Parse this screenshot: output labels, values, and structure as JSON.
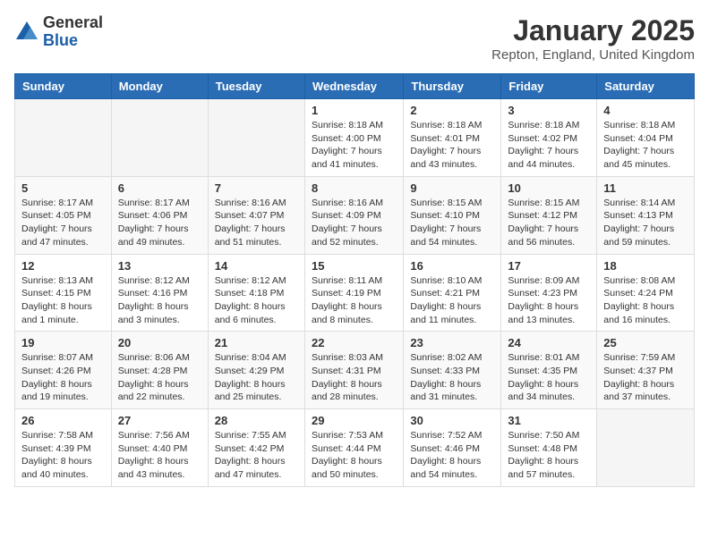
{
  "logo": {
    "general": "General",
    "blue": "Blue"
  },
  "title": "January 2025",
  "location": "Repton, England, United Kingdom",
  "weekdays": [
    "Sunday",
    "Monday",
    "Tuesday",
    "Wednesday",
    "Thursday",
    "Friday",
    "Saturday"
  ],
  "weeks": [
    [
      {
        "day": "",
        "sunrise": "",
        "sunset": "",
        "daylight": ""
      },
      {
        "day": "",
        "sunrise": "",
        "sunset": "",
        "daylight": ""
      },
      {
        "day": "",
        "sunrise": "",
        "sunset": "",
        "daylight": ""
      },
      {
        "day": "1",
        "sunrise": "Sunrise: 8:18 AM",
        "sunset": "Sunset: 4:00 PM",
        "daylight": "Daylight: 7 hours and 41 minutes."
      },
      {
        "day": "2",
        "sunrise": "Sunrise: 8:18 AM",
        "sunset": "Sunset: 4:01 PM",
        "daylight": "Daylight: 7 hours and 43 minutes."
      },
      {
        "day": "3",
        "sunrise": "Sunrise: 8:18 AM",
        "sunset": "Sunset: 4:02 PM",
        "daylight": "Daylight: 7 hours and 44 minutes."
      },
      {
        "day": "4",
        "sunrise": "Sunrise: 8:18 AM",
        "sunset": "Sunset: 4:04 PM",
        "daylight": "Daylight: 7 hours and 45 minutes."
      }
    ],
    [
      {
        "day": "5",
        "sunrise": "Sunrise: 8:17 AM",
        "sunset": "Sunset: 4:05 PM",
        "daylight": "Daylight: 7 hours and 47 minutes."
      },
      {
        "day": "6",
        "sunrise": "Sunrise: 8:17 AM",
        "sunset": "Sunset: 4:06 PM",
        "daylight": "Daylight: 7 hours and 49 minutes."
      },
      {
        "day": "7",
        "sunrise": "Sunrise: 8:16 AM",
        "sunset": "Sunset: 4:07 PM",
        "daylight": "Daylight: 7 hours and 51 minutes."
      },
      {
        "day": "8",
        "sunrise": "Sunrise: 8:16 AM",
        "sunset": "Sunset: 4:09 PM",
        "daylight": "Daylight: 7 hours and 52 minutes."
      },
      {
        "day": "9",
        "sunrise": "Sunrise: 8:15 AM",
        "sunset": "Sunset: 4:10 PM",
        "daylight": "Daylight: 7 hours and 54 minutes."
      },
      {
        "day": "10",
        "sunrise": "Sunrise: 8:15 AM",
        "sunset": "Sunset: 4:12 PM",
        "daylight": "Daylight: 7 hours and 56 minutes."
      },
      {
        "day": "11",
        "sunrise": "Sunrise: 8:14 AM",
        "sunset": "Sunset: 4:13 PM",
        "daylight": "Daylight: 7 hours and 59 minutes."
      }
    ],
    [
      {
        "day": "12",
        "sunrise": "Sunrise: 8:13 AM",
        "sunset": "Sunset: 4:15 PM",
        "daylight": "Daylight: 8 hours and 1 minute."
      },
      {
        "day": "13",
        "sunrise": "Sunrise: 8:12 AM",
        "sunset": "Sunset: 4:16 PM",
        "daylight": "Daylight: 8 hours and 3 minutes."
      },
      {
        "day": "14",
        "sunrise": "Sunrise: 8:12 AM",
        "sunset": "Sunset: 4:18 PM",
        "daylight": "Daylight: 8 hours and 6 minutes."
      },
      {
        "day": "15",
        "sunrise": "Sunrise: 8:11 AM",
        "sunset": "Sunset: 4:19 PM",
        "daylight": "Daylight: 8 hours and 8 minutes."
      },
      {
        "day": "16",
        "sunrise": "Sunrise: 8:10 AM",
        "sunset": "Sunset: 4:21 PM",
        "daylight": "Daylight: 8 hours and 11 minutes."
      },
      {
        "day": "17",
        "sunrise": "Sunrise: 8:09 AM",
        "sunset": "Sunset: 4:23 PM",
        "daylight": "Daylight: 8 hours and 13 minutes."
      },
      {
        "day": "18",
        "sunrise": "Sunrise: 8:08 AM",
        "sunset": "Sunset: 4:24 PM",
        "daylight": "Daylight: 8 hours and 16 minutes."
      }
    ],
    [
      {
        "day": "19",
        "sunrise": "Sunrise: 8:07 AM",
        "sunset": "Sunset: 4:26 PM",
        "daylight": "Daylight: 8 hours and 19 minutes."
      },
      {
        "day": "20",
        "sunrise": "Sunrise: 8:06 AM",
        "sunset": "Sunset: 4:28 PM",
        "daylight": "Daylight: 8 hours and 22 minutes."
      },
      {
        "day": "21",
        "sunrise": "Sunrise: 8:04 AM",
        "sunset": "Sunset: 4:29 PM",
        "daylight": "Daylight: 8 hours and 25 minutes."
      },
      {
        "day": "22",
        "sunrise": "Sunrise: 8:03 AM",
        "sunset": "Sunset: 4:31 PM",
        "daylight": "Daylight: 8 hours and 28 minutes."
      },
      {
        "day": "23",
        "sunrise": "Sunrise: 8:02 AM",
        "sunset": "Sunset: 4:33 PM",
        "daylight": "Daylight: 8 hours and 31 minutes."
      },
      {
        "day": "24",
        "sunrise": "Sunrise: 8:01 AM",
        "sunset": "Sunset: 4:35 PM",
        "daylight": "Daylight: 8 hours and 34 minutes."
      },
      {
        "day": "25",
        "sunrise": "Sunrise: 7:59 AM",
        "sunset": "Sunset: 4:37 PM",
        "daylight": "Daylight: 8 hours and 37 minutes."
      }
    ],
    [
      {
        "day": "26",
        "sunrise": "Sunrise: 7:58 AM",
        "sunset": "Sunset: 4:39 PM",
        "daylight": "Daylight: 8 hours and 40 minutes."
      },
      {
        "day": "27",
        "sunrise": "Sunrise: 7:56 AM",
        "sunset": "Sunset: 4:40 PM",
        "daylight": "Daylight: 8 hours and 43 minutes."
      },
      {
        "day": "28",
        "sunrise": "Sunrise: 7:55 AM",
        "sunset": "Sunset: 4:42 PM",
        "daylight": "Daylight: 8 hours and 47 minutes."
      },
      {
        "day": "29",
        "sunrise": "Sunrise: 7:53 AM",
        "sunset": "Sunset: 4:44 PM",
        "daylight": "Daylight: 8 hours and 50 minutes."
      },
      {
        "day": "30",
        "sunrise": "Sunrise: 7:52 AM",
        "sunset": "Sunset: 4:46 PM",
        "daylight": "Daylight: 8 hours and 54 minutes."
      },
      {
        "day": "31",
        "sunrise": "Sunrise: 7:50 AM",
        "sunset": "Sunset: 4:48 PM",
        "daylight": "Daylight: 8 hours and 57 minutes."
      },
      {
        "day": "",
        "sunrise": "",
        "sunset": "",
        "daylight": ""
      }
    ]
  ]
}
